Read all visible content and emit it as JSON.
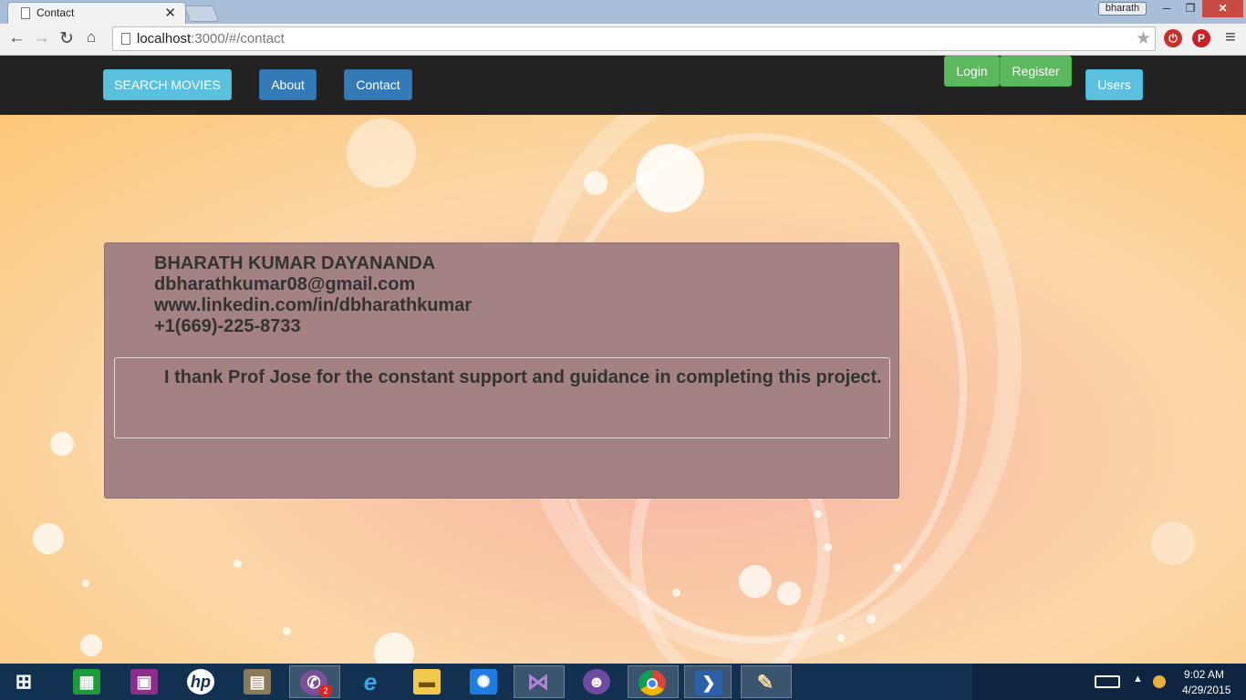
{
  "browser": {
    "tab_title": "Contact",
    "tab_close": "✕",
    "user_badge": "bharath",
    "address_host": "localhost",
    "address_path": ":3000/#/contact",
    "minimize": "─",
    "restore": "❐",
    "close": "✕",
    "icons": [
      "back-arrow-icon",
      "forward-arrow-icon",
      "reload-icon",
      "home-icon",
      "star-icon",
      "menu-icon"
    ]
  },
  "navbar": {
    "search_movies": "SEARCH MOVIES",
    "about": "About",
    "contact": "Contact",
    "login": "Login",
    "register": "Register",
    "users": "Users"
  },
  "contact": {
    "name": "BHARATH KUMAR DAYANANDA",
    "email": "dbharathkumar08@gmail.com",
    "linkedin": "www.linkedin.com/in/dbharathkumar",
    "phone": "+1(669)-225-8733",
    "thanks": "I thank Prof Jose for the constant support and guidance in completing this project."
  },
  "taskbar": {
    "viber_badge": "2",
    "time": "9:02 AM",
    "date": "4/29/2015"
  },
  "colors": {
    "navbar_bg": "#222222",
    "btn_info": "#5bc0de",
    "btn_primary": "#337ab7",
    "btn_success": "#5cb85c",
    "panel_bg": "#a48182",
    "taskbar_bg": "#12304f"
  }
}
